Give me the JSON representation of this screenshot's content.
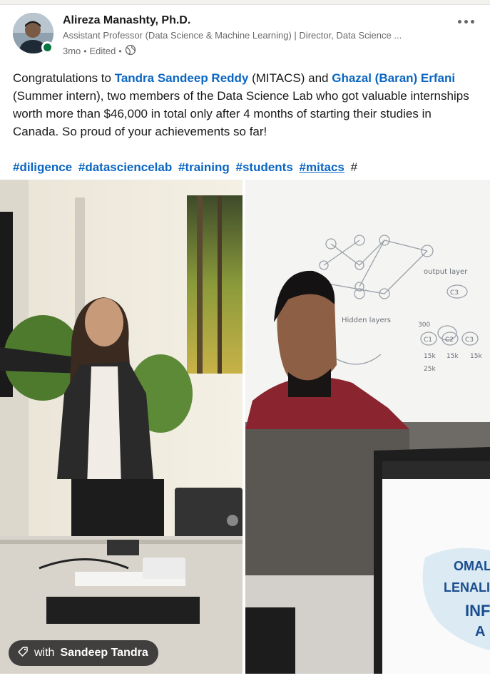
{
  "post": {
    "author": {
      "name": "Alireza Manashty, Ph.D.",
      "headline": "Assistant Professor (Data Science & Machine Learning) | Director, Data Science ...",
      "time": "3mo",
      "edited": "Edited",
      "separator": "•",
      "visibility_icon": "globe-icon",
      "presence": "online"
    },
    "body": {
      "p1": "Congratulations to ",
      "mention1": "Tandra Sandeep Reddy",
      "p2": " (MITACS) and ",
      "mention2": "Ghazal (Baran) Erfani",
      "p3": " (Summer intern), two members of the Data Science Lab who got valuable internships worth more than $46,000 in total only after 4 months of starting their studies in Canada. So proud of your achievements so far!"
    },
    "hashtags": [
      "#diligence",
      "#datasciencelab",
      "#training",
      "#students",
      "#mitacs"
    ],
    "hashtag_trailing": "#",
    "photo_tag": {
      "prefix": "with",
      "name": "Sandeep Tandra"
    },
    "whiteboard_notes": {
      "output_layer": "output layer",
      "hidden_layers": "Hidden layers",
      "c1": "C1",
      "c2": "C2",
      "c3": "C3",
      "n1": "15k",
      "n2": "15k",
      "n3": "15k",
      "total": "25k",
      "nums": "300"
    },
    "screen_words": [
      "OMALI",
      "LENALI",
      "INF",
      "A"
    ]
  },
  "colors": {
    "link": "#0a66c2",
    "online": "#057642",
    "background": "#f3f2ef"
  }
}
